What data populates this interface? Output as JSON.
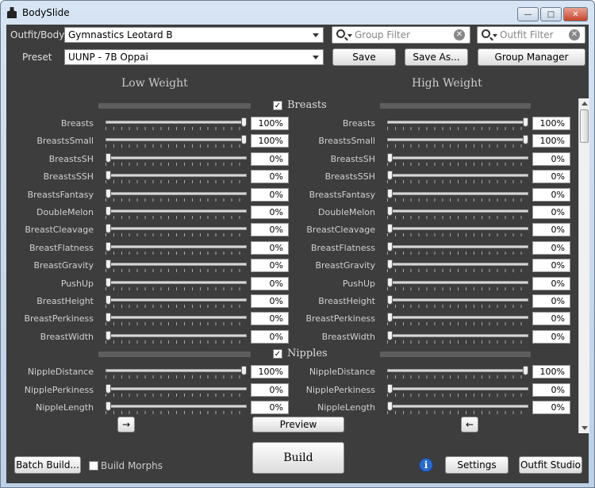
{
  "window": {
    "title": "BodySlide",
    "min_label": "—",
    "max_label": "□",
    "close_label": "✕"
  },
  "top": {
    "outfit_label": "Outfit/Body",
    "outfit_value": "Gymnastics Leotard B",
    "preset_label": "Preset",
    "preset_value": "UUNP - 7B Oppai",
    "group_filter_placeholder": "Group Filter",
    "outfit_filter_placeholder": "Outfit Filter",
    "save_label": "Save",
    "save_as_label": "Save As...",
    "group_manager_label": "Group Manager"
  },
  "weights": {
    "low": "Low Weight",
    "high": "High Weight"
  },
  "groups": [
    {
      "name": "Breasts",
      "checked": true,
      "sliders": [
        {
          "name": "Breasts",
          "low": 100,
          "high": 100
        },
        {
          "name": "BreastsSmall",
          "low": 100,
          "high": 100
        },
        {
          "name": "BreastsSH",
          "low": 0,
          "high": 0
        },
        {
          "name": "BreastsSSH",
          "low": 0,
          "high": 0
        },
        {
          "name": "BreastsFantasy",
          "low": 0,
          "high": 0
        },
        {
          "name": "DoubleMelon",
          "low": 0,
          "high": 0
        },
        {
          "name": "BreastCleavage",
          "low": 0,
          "high": 0
        },
        {
          "name": "BreastFlatness",
          "low": 0,
          "high": 0
        },
        {
          "name": "BreastGravity",
          "low": 0,
          "high": 0
        },
        {
          "name": "PushUp",
          "low": 0,
          "high": 0
        },
        {
          "name": "BreastHeight",
          "low": 0,
          "high": 0
        },
        {
          "name": "BreastPerkiness",
          "low": 0,
          "high": 0
        },
        {
          "name": "BreastWidth",
          "low": 0,
          "high": 0
        }
      ]
    },
    {
      "name": "Nipples",
      "checked": true,
      "sliders": [
        {
          "name": "NippleDistance",
          "low": 100,
          "high": 100
        },
        {
          "name": "NipplePerkiness",
          "low": 0,
          "high": 0
        },
        {
          "name": "NippleLength",
          "low": 0,
          "high": 0
        }
      ]
    }
  ],
  "bottom": {
    "copy_right_label": "→",
    "preview_label": "Preview",
    "copy_left_label": "←",
    "batch_build_label": "Batch Build...",
    "build_morphs_label": "Build Morphs",
    "build_label": "Build",
    "info_label": "i",
    "settings_label": "Settings",
    "outfit_studio_label": "Outfit Studio"
  }
}
